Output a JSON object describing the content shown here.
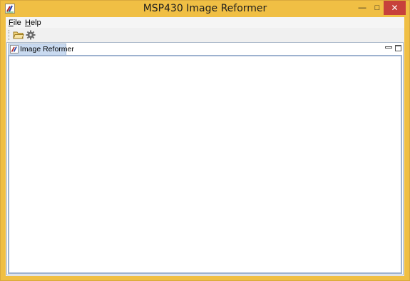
{
  "window": {
    "title": "MSP430 Image Reformer",
    "controls": {
      "minimize": "—",
      "maximize": "□",
      "close": "✕"
    },
    "icon": "app-brush-icon"
  },
  "menubar": {
    "items": [
      {
        "mnemonic": "F",
        "rest": "ile"
      },
      {
        "mnemonic": "H",
        "rest": "elp"
      }
    ]
  },
  "toolbar": {
    "buttons": [
      {
        "icon": "open-folder-icon"
      },
      {
        "icon": "gear-icon"
      }
    ]
  },
  "panel": {
    "tab_label": "Image Reformer",
    "tab_icon": "app-brush-icon",
    "colors": {
      "tab_bg": "#c9daf0",
      "border": "#9db2cf"
    }
  },
  "colors": {
    "frame": "#f0bf44",
    "close_button": "#c7413b"
  }
}
